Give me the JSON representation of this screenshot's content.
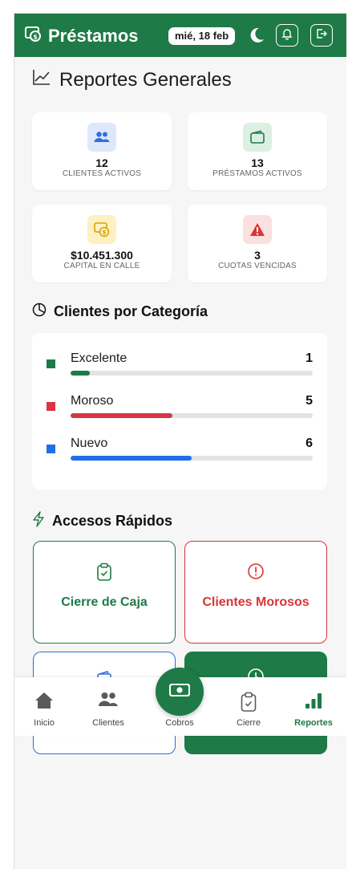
{
  "header": {
    "app_title": "Préstamos",
    "date": "mié, 18 feb"
  },
  "page_title": "Reportes Generales",
  "stats": [
    {
      "value": "12",
      "label": "CLIENTES ACTIVOS",
      "icon": "users-icon",
      "color": "#2f6fdb"
    },
    {
      "value": "13",
      "label": "PRÉSTAMOS ACTIVOS",
      "icon": "wallet-icon",
      "color": "#1e7a46"
    },
    {
      "value": "$10.451.300",
      "label": "CAPITAL EN CALLE",
      "icon": "money-icon",
      "color": "#d9a300"
    },
    {
      "value": "3",
      "label": "CUOTAS VENCIDAS",
      "icon": "warning-icon",
      "color": "#d83535"
    }
  ],
  "categories": {
    "title": "Clientes por Categoría",
    "items": [
      {
        "name": "Excelente",
        "count": "1",
        "color": "#1e7a46",
        "fraction": 0.08
      },
      {
        "name": "Moroso",
        "count": "5",
        "color": "#d83545",
        "fraction": 0.42
      },
      {
        "name": "Nuevo",
        "count": "6",
        "color": "#1f6fe8",
        "fraction": 0.5
      }
    ]
  },
  "quick_access": {
    "title": "Accesos Rápidos",
    "items": [
      {
        "label": "Cierre de Caja",
        "color": "#1e7a46"
      },
      {
        "label": "Clientes Morosos",
        "color": "#d83535"
      }
    ]
  },
  "nav": {
    "items": [
      {
        "label": "Inicio"
      },
      {
        "label": "Clientes"
      },
      {
        "label": "Cobros"
      },
      {
        "label": "Cierre"
      },
      {
        "label": "Reportes"
      }
    ],
    "active_color": "#1e7a46"
  }
}
